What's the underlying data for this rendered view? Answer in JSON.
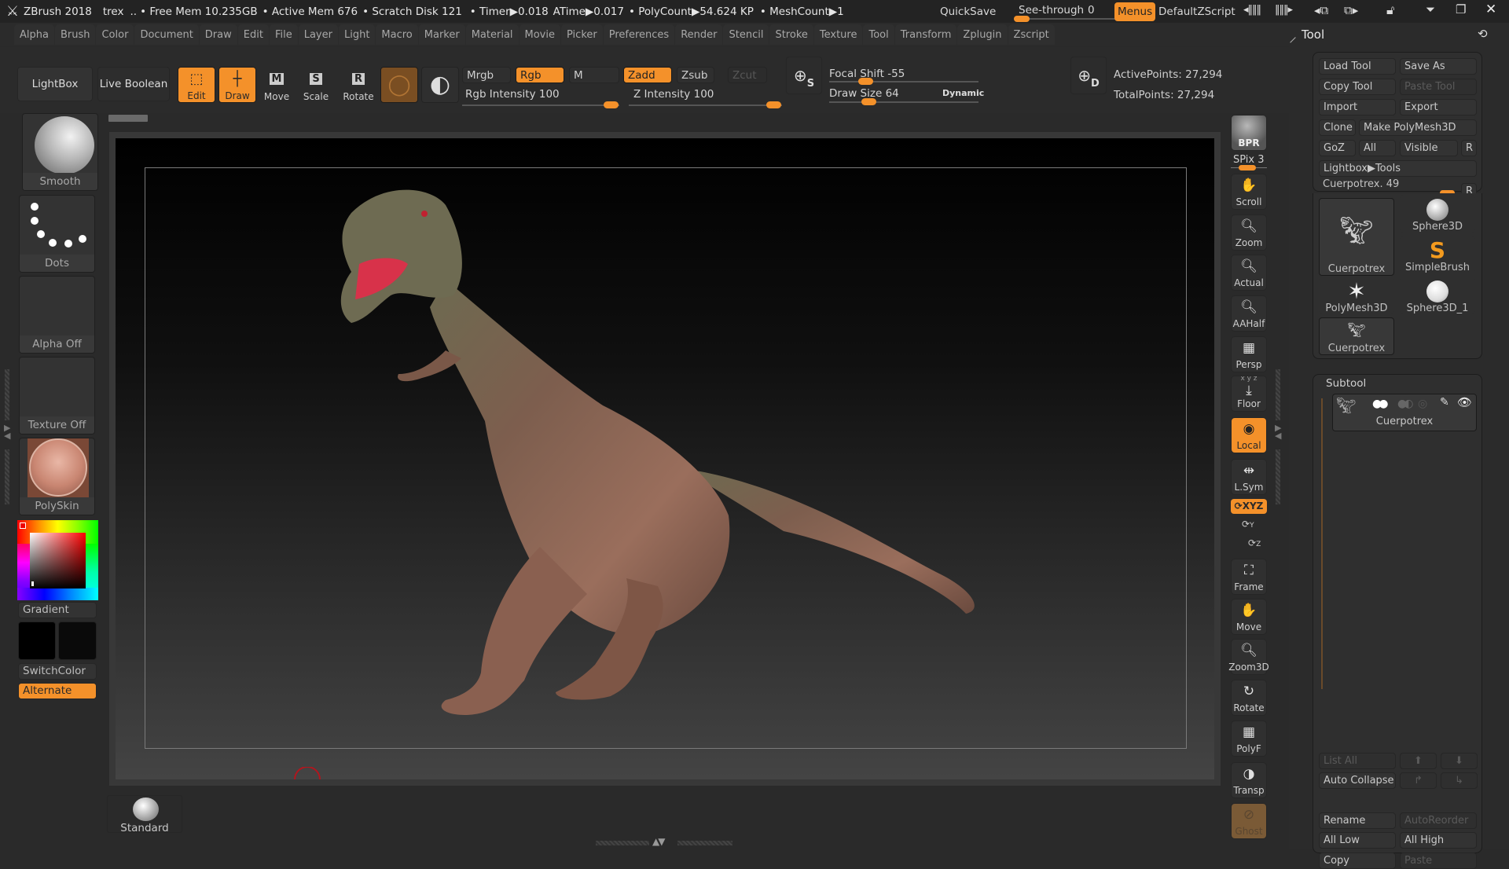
{
  "titlebar": {
    "app": "ZBrush 2018",
    "document": "trex",
    "separator": "..",
    "free_mem": "• Free Mem 10.235GB",
    "active_mem": "• Active Mem 676",
    "scratch_disk": "• Scratch Disk 121",
    "timer": "• Timer▶0.018",
    "atime": "ATime▶0.017",
    "polycount": "• PolyCount▶54.624 KP",
    "meshcount": "• MeshCount▶1",
    "quicksave": "QuickSave",
    "see_through_label": "See-through",
    "see_through_value": "0",
    "menus": "Menus",
    "default_zscript": "DefaultZScript"
  },
  "menus": [
    "Alpha",
    "Brush",
    "Color",
    "Document",
    "Draw",
    "Edit",
    "File",
    "Layer",
    "Light",
    "Macro",
    "Marker",
    "Material",
    "Movie",
    "Picker",
    "Preferences",
    "Render",
    "Stencil",
    "Stroke",
    "Texture",
    "Tool",
    "Transform",
    "Zplugin",
    "Zscript"
  ],
  "toolbar": {
    "lightbox": "LightBox",
    "live_boolean": "Live Boolean",
    "edit": "Edit",
    "draw": "Draw",
    "move": "Move",
    "scale": "Scale",
    "rotate": "Rotate",
    "move_key": "M",
    "scale_key": "S",
    "rotate_key": "R",
    "mrgb": "Mrgb",
    "rgb": "Rgb",
    "m": "M",
    "zadd": "Zadd",
    "zsub": "Zsub",
    "zcut": "Zcut",
    "rgb_intensity_label": "Rgb Intensity",
    "rgb_intensity": 100,
    "z_intensity_label": "Z Intensity",
    "z_intensity": 100,
    "focal_shift_label": "Focal Shift",
    "focal_shift": -55,
    "draw_size_label": "Draw Size",
    "draw_size": 64,
    "dynamic": "Dynamic",
    "active_points": "ActivePoints: 27,294",
    "total_points": "TotalPoints: 27,294",
    "s_key": "S",
    "d_key": "D"
  },
  "left_shelf": {
    "brush": "Smooth",
    "stroke": "Dots",
    "alpha": "Alpha Off",
    "texture": "Texture Off",
    "material": "PolySkin",
    "gradient": "Gradient",
    "switch_color": "SwitchColor",
    "alternate": "Alternate",
    "colors": {
      "main": "#000000",
      "secondary": "#0a0a0a",
      "accent": "#f4912a"
    }
  },
  "bottom_shelf": {
    "brush": "Standard"
  },
  "right_rail": {
    "bpr": "BPR",
    "spix_label": "SPix",
    "spix": 3,
    "scroll": "Scroll",
    "zoom": "Zoom",
    "actual": "Actual",
    "aahalf": "AAHalf",
    "persp": "Persp",
    "floor": "Floor",
    "floor_axes": "x y z",
    "local": "Local",
    "lsym": "L.Sym",
    "xyz": "XYZ",
    "y": "Y",
    "z": "Z",
    "frame": "Frame",
    "move": "Move",
    "zoom3d": "Zoom3D",
    "rotate": "Rotate",
    "polyf": "PolyF",
    "transp": "Transp",
    "ghost": "Ghost"
  },
  "tool_panel": {
    "title": "Tool",
    "load_tool": "Load Tool",
    "save_as": "Save As",
    "copy_tool": "Copy Tool",
    "paste_tool": "Paste Tool",
    "import": "Import",
    "export": "Export",
    "clone": "Clone",
    "make_polymesh": "Make PolyMesh3D",
    "goz": "GoZ",
    "all": "All",
    "visible": "Visible",
    "r": "R",
    "lightbox_tools": "Lightbox▶Tools",
    "current_tool_label": "Cuerpotrex.",
    "current_tool_value": 49,
    "tools": [
      {
        "name": "Cuerpotrex",
        "selected": true
      },
      {
        "name": "Sphere3D"
      },
      {
        "name": "SimpleBrush"
      },
      {
        "name": "PolyMesh3D"
      },
      {
        "name": "Sphere3D_1"
      },
      {
        "name": "Cuerpotrex"
      }
    ],
    "subtool": {
      "title": "Subtool",
      "items": [
        {
          "name": "Cuerpotrex"
        }
      ],
      "list_all": "List All",
      "auto_collapse": "Auto Collapse",
      "rename": "Rename",
      "auto_reorder": "AutoReorder",
      "all_low": "All Low",
      "all_high": "All High",
      "copy": "Copy",
      "paste": "Paste"
    }
  }
}
